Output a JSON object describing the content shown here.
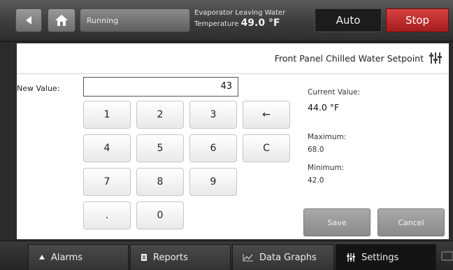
{
  "header": {
    "running_label": "Running",
    "evap_line1": "Evaporator Leaving Water",
    "evap_line2_label": "Temperature",
    "evap_value": "49.0 °F",
    "auto_label": "Auto",
    "stop_label": "Stop"
  },
  "panel": {
    "title": "Front Panel Chilled Water Setpoint",
    "new_value_label": "New Value:",
    "new_value": "43",
    "keypad": {
      "k1": "1",
      "k2": "2",
      "k3": "3",
      "back": "←",
      "k4": "4",
      "k5": "5",
      "k6": "6",
      "clear": "C",
      "k7": "7",
      "k8": "8",
      "k9": "9",
      "dot": ".",
      "k0": "0"
    },
    "current_label": "Current Value:",
    "current_value": "44.0 °F",
    "max_label": "Maximum:",
    "max_value": "68.0",
    "min_label": "Minimum:",
    "min_value": "42.0",
    "save_label": "Save",
    "cancel_label": "Cancel"
  },
  "footer": {
    "tabs": [
      {
        "label": "Alarms",
        "icon": "bell-icon"
      },
      {
        "label": "Reports",
        "icon": "document-icon"
      },
      {
        "label": "Data Graphs",
        "icon": "graph-icon"
      },
      {
        "label": "Settings",
        "icon": "settings-icon",
        "active": true
      }
    ]
  },
  "colors": {
    "stop_red": "#c82a2a",
    "panel_bg": "#ffffff",
    "bar_dark": "#2b2b2b"
  }
}
